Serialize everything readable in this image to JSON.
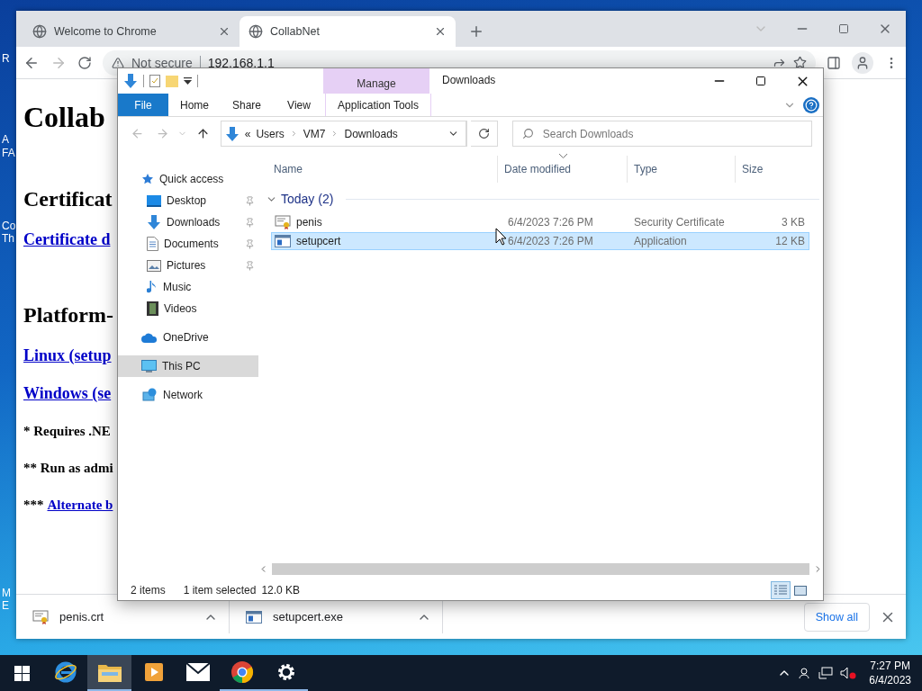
{
  "desktop": {
    "label_fragments": [
      {
        "text": "R"
      },
      {
        "text": "A"
      },
      {
        "text": "FA"
      },
      {
        "text": "Co"
      },
      {
        "text": "Th"
      },
      {
        "text": "M"
      },
      {
        "text": "E"
      }
    ]
  },
  "chrome": {
    "tabs": [
      {
        "title": "Welcome to Chrome",
        "selected": false
      },
      {
        "title": "CollabNet",
        "selected": true
      }
    ],
    "omnibox": {
      "security": "Not secure",
      "url": "192.168.1.1"
    },
    "page": [
      {
        "kind": "title",
        "text": "Collab"
      },
      {
        "kind": "heading",
        "text": "Certificat"
      },
      {
        "kind": "link",
        "text": "Certificate d"
      },
      {
        "kind": "heading",
        "text": "Platform-"
      },
      {
        "kind": "link",
        "text": "Linux (setup"
      },
      {
        "kind": "link",
        "text": "Windows (se"
      },
      {
        "kind": "note",
        "text": "* Requires .NE"
      },
      {
        "kind": "note",
        "text": "** Run as admi"
      },
      {
        "kind": "note",
        "text": "***",
        "link": "Alternate b"
      }
    ],
    "downloads": [
      {
        "name": "penis.crt",
        "kind": "certificate"
      },
      {
        "name": "setupcert.exe",
        "kind": "application"
      }
    ],
    "show_all": "Show all"
  },
  "explorer": {
    "title": "Downloads",
    "context_tab": "Manage",
    "ribbon_tabs": [
      {
        "label": "File",
        "kind": "file"
      },
      {
        "label": "Home",
        "kind": "plain"
      },
      {
        "label": "Share",
        "kind": "plain"
      },
      {
        "label": "View",
        "kind": "plain"
      },
      {
        "label": "Application Tools",
        "kind": "context"
      }
    ],
    "address": {
      "overflow": "«",
      "path": [
        "Users",
        "VM7",
        "Downloads"
      ]
    },
    "search": {
      "placeholder": "Search Downloads"
    },
    "nav": [
      {
        "label": "Quick access",
        "kind": "star",
        "selected": false,
        "children": [
          {
            "label": "Desktop",
            "kind": "desktop",
            "pinned": true,
            "selected": false
          },
          {
            "label": "Downloads",
            "kind": "download",
            "pinned": true,
            "selected": false
          },
          {
            "label": "Documents",
            "kind": "document",
            "pinned": true,
            "selected": false
          },
          {
            "label": "Pictures",
            "kind": "picture",
            "pinned": true,
            "selected": false
          },
          {
            "label": "Music",
            "kind": "music",
            "pinned": false,
            "selected": false
          },
          {
            "label": "Videos",
            "kind": "video",
            "pinned": false,
            "selected": false
          }
        ]
      },
      {
        "label": "OneDrive",
        "kind": "cloud",
        "selected": false
      },
      {
        "label": "This PC",
        "kind": "pc",
        "selected": true
      },
      {
        "label": "Network",
        "kind": "network",
        "selected": false
      }
    ],
    "columns": [
      {
        "label": "Name",
        "sorted": false
      },
      {
        "label": "Date modified",
        "sorted": true
      },
      {
        "label": "Type",
        "sorted": false
      },
      {
        "label": "Size",
        "sorted": false
      }
    ],
    "group": {
      "label": "Today (2)",
      "expanded": true
    },
    "files": [
      {
        "name": "penis",
        "date": "6/4/2023 7:26 PM",
        "type": "Security Certificate",
        "size": "3 KB",
        "kind": "certificate",
        "selected": false
      },
      {
        "name": "setupcert",
        "date": "6/4/2023 7:26 PM",
        "type": "Application",
        "size": "12 KB",
        "kind": "application",
        "selected": true
      }
    ],
    "status": {
      "count": "2 items",
      "selection": "1 item selected",
      "selection_size": "12.0 KB"
    },
    "view_buttons": [
      {
        "kind": "details",
        "selected": true
      },
      {
        "kind": "large",
        "selected": false
      }
    ]
  },
  "taskbar": {
    "apps": [
      {
        "kind": "ie",
        "open": false,
        "active": false
      },
      {
        "kind": "folder",
        "open": true,
        "active": true
      },
      {
        "kind": "media",
        "open": false,
        "active": false
      },
      {
        "kind": "mail",
        "open": false,
        "active": false
      },
      {
        "kind": "chrome",
        "open": true,
        "active": false
      },
      {
        "kind": "settings",
        "open": true,
        "active": false
      }
    ],
    "time": "7:27 PM",
    "date": "6/4/2023"
  }
}
